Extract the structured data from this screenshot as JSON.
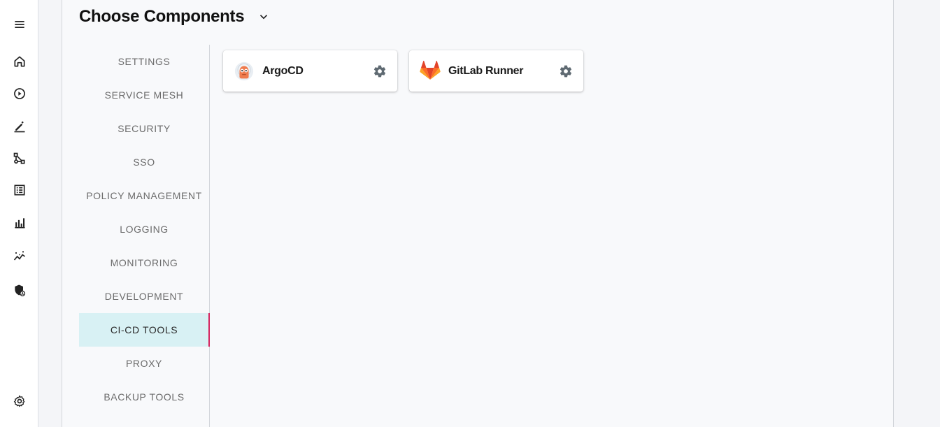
{
  "nav_rail": {
    "items": [
      {
        "name": "menu-icon"
      },
      {
        "name": "home-icon"
      },
      {
        "name": "play-icon"
      },
      {
        "name": "edit-icon"
      },
      {
        "name": "share-icon"
      },
      {
        "name": "list-icon"
      },
      {
        "name": "bar-chart-icon"
      },
      {
        "name": "insights-icon"
      },
      {
        "name": "security-shield-icon"
      }
    ],
    "bottom_item": {
      "name": "settings-gear-icon"
    }
  },
  "header": {
    "title": "Choose Components"
  },
  "tabs": [
    {
      "label": "SETTINGS",
      "active": false
    },
    {
      "label": "SERVICE MESH",
      "active": false
    },
    {
      "label": "SECURITY",
      "active": false
    },
    {
      "label": "SSO",
      "active": false
    },
    {
      "label": "POLICY MANAGEMENT",
      "active": false
    },
    {
      "label": "LOGGING",
      "active": false
    },
    {
      "label": "MONITORING",
      "active": false
    },
    {
      "label": "DEVELOPMENT",
      "active": false
    },
    {
      "label": "CI-CD TOOLS",
      "active": true
    },
    {
      "label": "PROXY",
      "active": false
    },
    {
      "label": "BACKUP TOOLS",
      "active": false
    }
  ],
  "components": [
    {
      "name": "ArgoCD",
      "logo": "argocd-logo-icon"
    },
    {
      "name": "GitLab Runner",
      "logo": "gitlab-logo-icon"
    }
  ],
  "colors": {
    "active_tab_bg": "#d8f1f4",
    "active_tab_indicator": "#d6245f",
    "panel_bg": "#f8f9fb"
  }
}
